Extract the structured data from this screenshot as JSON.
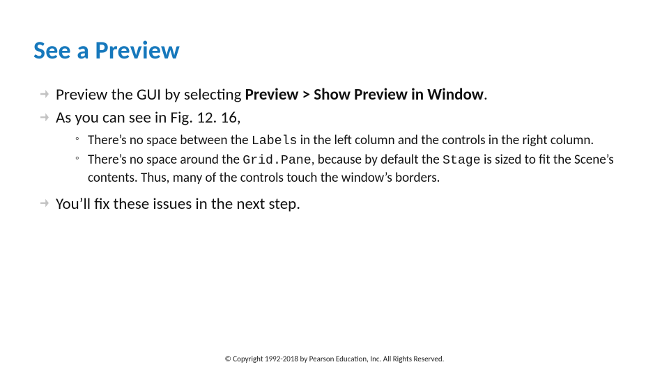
{
  "title": "See a Preview",
  "bullets": [
    {
      "pre": "Preview the GUI by selecting ",
      "bold": "Preview > Show Preview in Window",
      "post": "."
    },
    {
      "text": "As you can see in Fig. 12. 16,",
      "sub": [
        {
          "a": "There’s no space between the ",
          "code1": "Labels",
          "b": " in the left column and the controls in the right column."
        },
        {
          "a": "There’s no space around the ",
          "code1": "Grid.Pane",
          "b": ", because by default the ",
          "code2": "Stage",
          "c": " is sized to fit the Scene’s contents. Thus, many of the controls touch the window’s borders."
        }
      ]
    },
    {
      "text": "You’ll fix these issues in the next step."
    }
  ],
  "footer": "© Copyright 1992-2018 by Pearson Education, Inc. All Rights Reserved."
}
